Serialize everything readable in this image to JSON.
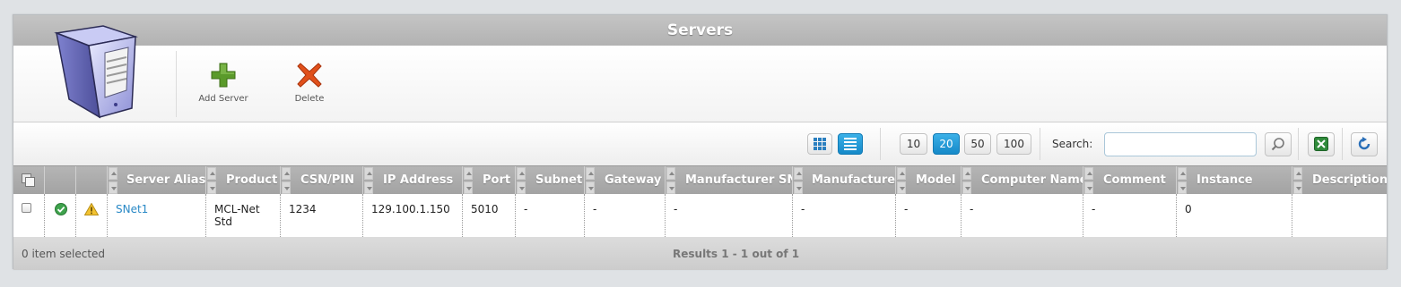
{
  "window": {
    "title": "Servers"
  },
  "toolbar": {
    "add_label": "Add Server",
    "delete_label": "Delete"
  },
  "view": {
    "active": "list"
  },
  "page_sizes": {
    "options": [
      "10",
      "20",
      "50",
      "100"
    ],
    "selected": "20"
  },
  "search": {
    "label": "Search:",
    "value": ""
  },
  "table": {
    "columns": [
      "Server Alias",
      "Product",
      "CSN/PIN",
      "IP Address",
      "Port",
      "Subnet",
      "Gateway",
      "Manufacturer SN",
      "Manufacturer",
      "Model",
      "Computer Name",
      "Comment",
      "Instance",
      "Description"
    ],
    "rows": [
      {
        "status": "connected",
        "warning": true,
        "alias": "SNet1",
        "product": "MCL-Net Std",
        "csn": "1234",
        "ip": "129.100.1.150",
        "port": "5010",
        "subnet": "-",
        "gateway": "-",
        "manufacturer_sn": "-",
        "manufacturer": "-",
        "model": "-",
        "computer_name": "-",
        "comment": "-",
        "instance": "0",
        "description": ""
      }
    ]
  },
  "footer": {
    "selected": "0 item selected",
    "results": "Results 1 - 1 out of 1"
  },
  "colors": {
    "accent": "#1a94d6",
    "link": "#2a89c6",
    "header_bg": "#b5b5b5",
    "add_green": "#5a9a2a",
    "delete_red": "#e0501b"
  }
}
